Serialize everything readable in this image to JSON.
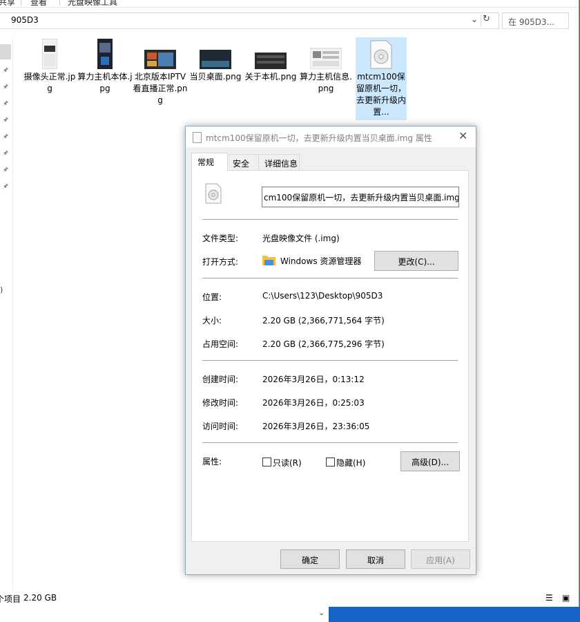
{
  "ribbon": {
    "tabs": [
      "共享",
      "查看",
      "光盘映像工具"
    ]
  },
  "address": {
    "path": "905D3",
    "search_placeholder": "在 905D3..."
  },
  "files": [
    {
      "name": "摄像头正常.jpg"
    },
    {
      "name": "算力主机本体.jpg"
    },
    {
      "name": "北京版本IPTV看直播正常.png"
    },
    {
      "name": "当贝桌面.png"
    },
    {
      "name": "关于本机.png"
    },
    {
      "name": "算力主机信息.png"
    },
    {
      "name": "mtcm100保留原机一切，去更新升级内置..."
    }
  ],
  "left_fragment": ")",
  "status": {
    "items_label": "个项目",
    "size": "2.20 GB"
  },
  "dialog": {
    "title": "mtcm100保留原机一切，去更新升级内置当贝桌面.img 属性",
    "tabs": [
      "常规",
      "安全",
      "详细信息"
    ],
    "filename": "cm100保留原机一切，去更新升级内置当贝桌面.img",
    "type_label": "文件类型:",
    "type_value": "光盘映像文件 (.img)",
    "open_label": "打开方式:",
    "open_value": "Windows 资源管理器",
    "change_button": "更改(C)...",
    "location_label": "位置:",
    "location_value": "C:\\Users\\123\\Desktop\\905D3",
    "size_label": "大小:",
    "size_value": "2.20 GB (2,366,771,564 字节)",
    "disk_label": "占用空间:",
    "disk_value": "2.20 GB (2,366,775,296 字节)",
    "created_label": "创建时间:",
    "created_value": "2026年3月26日，0:13:12",
    "modified_label": "修改时间:",
    "modified_value": "2026年3月26日，0:25:03",
    "accessed_label": "访问时间:",
    "accessed_value": "2026年3月26日，23:36:05",
    "attr_label": "属性:",
    "readonly_label": "只读(R)",
    "hidden_label": "隐藏(H)",
    "advanced_button": "高级(D)...",
    "ok_button": "确定",
    "cancel_button": "取消",
    "apply_button": "应用(A)"
  }
}
